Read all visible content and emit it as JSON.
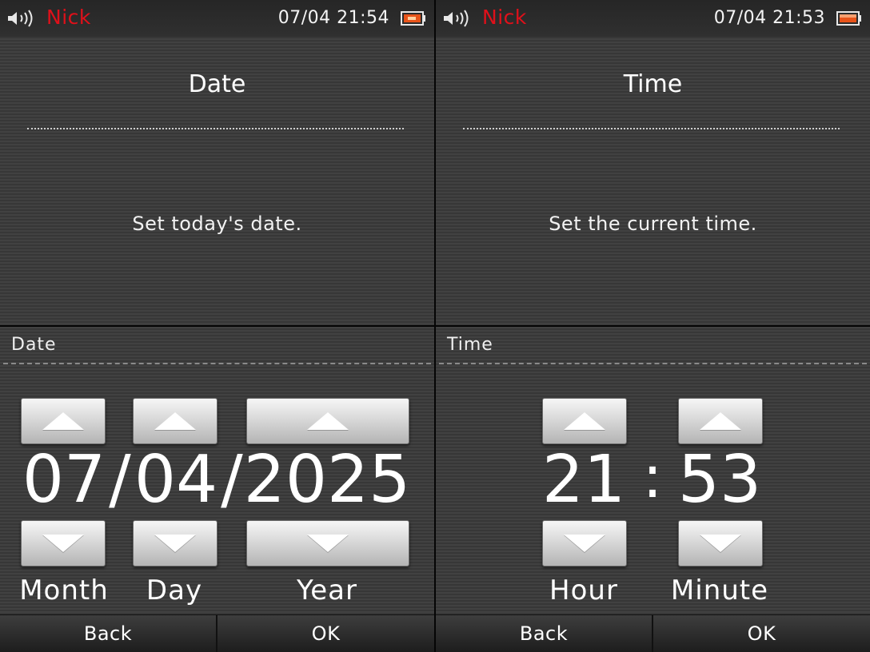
{
  "status": {
    "left": {
      "user": "Nick",
      "clock": "07/04 21:54",
      "speaker_icon": "speaker-volume-icon",
      "battery_icon": "battery-icon"
    },
    "right": {
      "user": "Nick",
      "clock": "07/04 21:53",
      "speaker_icon": "speaker-volume-icon",
      "battery_icon": "battery-icon"
    }
  },
  "date_screen": {
    "title": "Date",
    "message": "Set today's date.",
    "section_label": "Date",
    "month": "07",
    "sep1": "/",
    "day": "04",
    "sep2": "/",
    "year": "2025",
    "labels": {
      "month": "Month",
      "day": "Day",
      "year": "Year"
    },
    "back_label": "Back",
    "ok_label": "OK"
  },
  "time_screen": {
    "title": "Time",
    "message": "Set the current time.",
    "section_label": "Time",
    "hour": "21",
    "colon": ":",
    "minute": "53",
    "labels": {
      "hour": "Hour",
      "minute": "Minute"
    },
    "back_label": "Back",
    "ok_label": "OK"
  },
  "colors": {
    "user_name": "#e0101a",
    "background": "#3a3a3a",
    "battery": "#e8541a"
  }
}
